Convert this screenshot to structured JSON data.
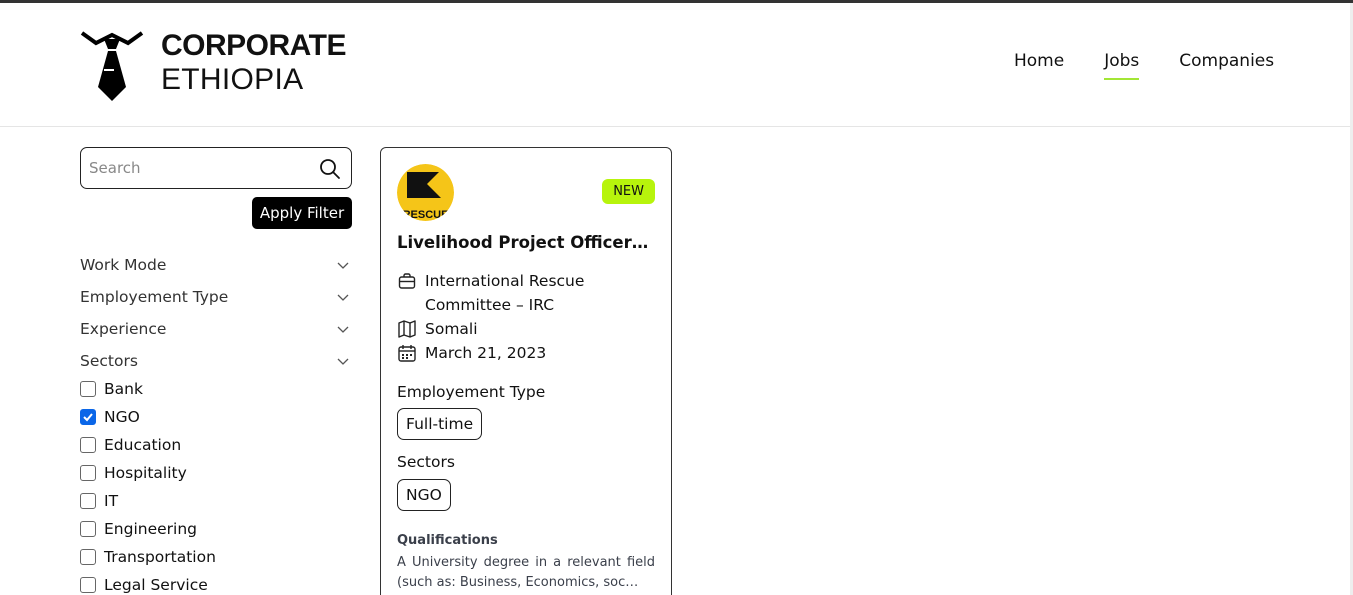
{
  "brand": {
    "line1": "CORPORATE",
    "line2": "ETHIOPIA"
  },
  "nav": [
    {
      "label": "Home",
      "active": false
    },
    {
      "label": "Jobs",
      "active": true
    },
    {
      "label": "Companies",
      "active": false
    }
  ],
  "search": {
    "placeholder": "Search",
    "value": ""
  },
  "apply_label": "Apply Filter",
  "filters": [
    {
      "label": "Work Mode"
    },
    {
      "label": "Employement Type"
    },
    {
      "label": "Experience"
    },
    {
      "label": "Sectors"
    }
  ],
  "sectors": [
    {
      "label": "Bank",
      "checked": false
    },
    {
      "label": "NGO",
      "checked": true
    },
    {
      "label": "Education",
      "checked": false
    },
    {
      "label": "Hospitality",
      "checked": false
    },
    {
      "label": "IT",
      "checked": false
    },
    {
      "label": "Engineering",
      "checked": false
    },
    {
      "label": "Transportation",
      "checked": false
    },
    {
      "label": "Legal Service",
      "checked": false
    }
  ],
  "job": {
    "badge": "NEW",
    "logo_text": "RESCUE",
    "title": "Livelihood Project Officer-...",
    "company": "International Rescue Committee – IRC",
    "location": "Somali",
    "date": "March 21, 2023",
    "employment_label": "Employement Type",
    "employment_value": "Full-time",
    "sectors_label": "Sectors",
    "sector_value": "NGO",
    "qual_label": "Qualifications",
    "qual_text": "A University degree in a relevant field (such as: Business, Economics, soc…"
  },
  "colors": {
    "accent": "#a3e635",
    "badge": "#b7f40c",
    "checkbox": "#0a66e8",
    "logo_yellow": "#f5c518"
  }
}
